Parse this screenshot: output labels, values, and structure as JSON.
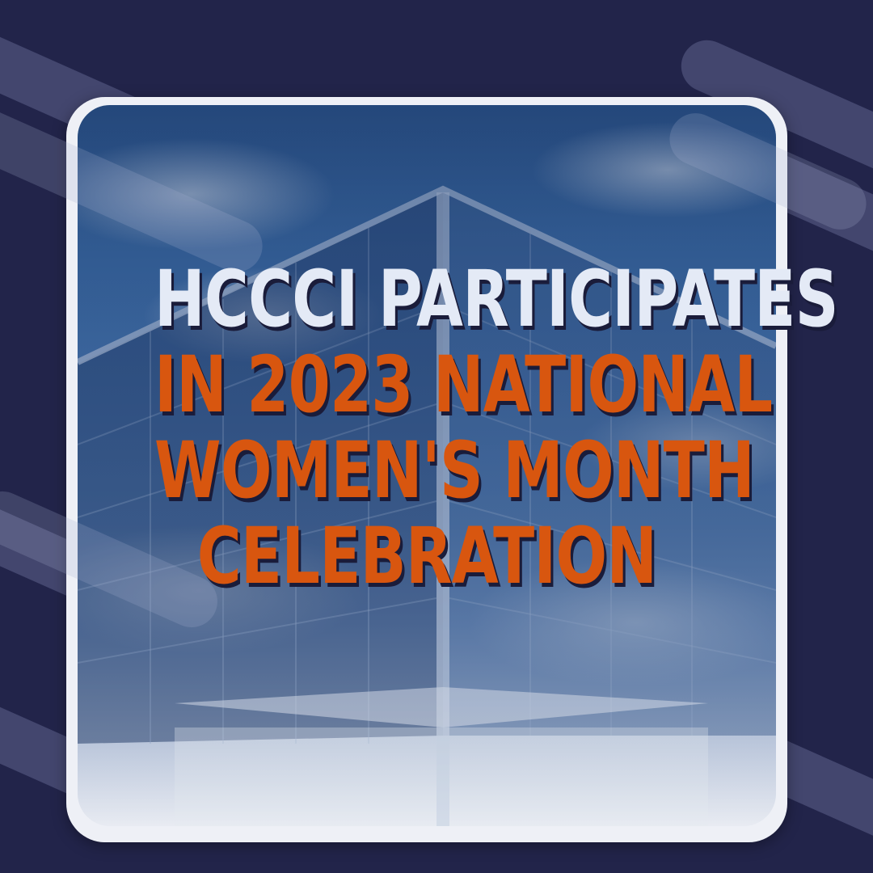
{
  "headline": {
    "line1": "HCCCI PARTICIPATES",
    "line2": "IN 2023 NATIONAL",
    "line3": "WOMEN'S MONTH",
    "line4": "CELEBRATION"
  },
  "colors": {
    "background": "#22244a",
    "frame": "#eef0f6",
    "headline_primary": "#e4eaf6",
    "headline_accent": "#d8560f",
    "text_shadow": "#1a1c3a"
  }
}
